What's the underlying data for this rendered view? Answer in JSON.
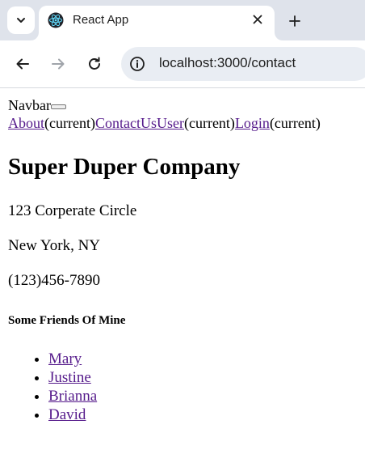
{
  "browser": {
    "tab_title": "React App",
    "url": "localhost:3000/contact"
  },
  "navbar": {
    "brand": "Navbar",
    "links": [
      {
        "label": "About",
        "suffix": "(current)"
      },
      {
        "label": "ContactUs",
        "suffix": ""
      },
      {
        "label": "User",
        "suffix": "(current)"
      },
      {
        "label": "Login",
        "suffix": "(current)"
      }
    ]
  },
  "company": {
    "name": "Super Duper Company",
    "address_line1": "123 Corperate Circle",
    "address_line2": "New York, NY",
    "phone": "(123)456-7890"
  },
  "friends": {
    "heading": "Some Friends Of Mine",
    "items": [
      "Mary",
      "Justine",
      "Brianna",
      "David"
    ]
  },
  "colors": {
    "link_visited": "#551a8b",
    "tabstrip_bg": "#dfe3eb",
    "omnibox_bg": "#e9edf3"
  }
}
